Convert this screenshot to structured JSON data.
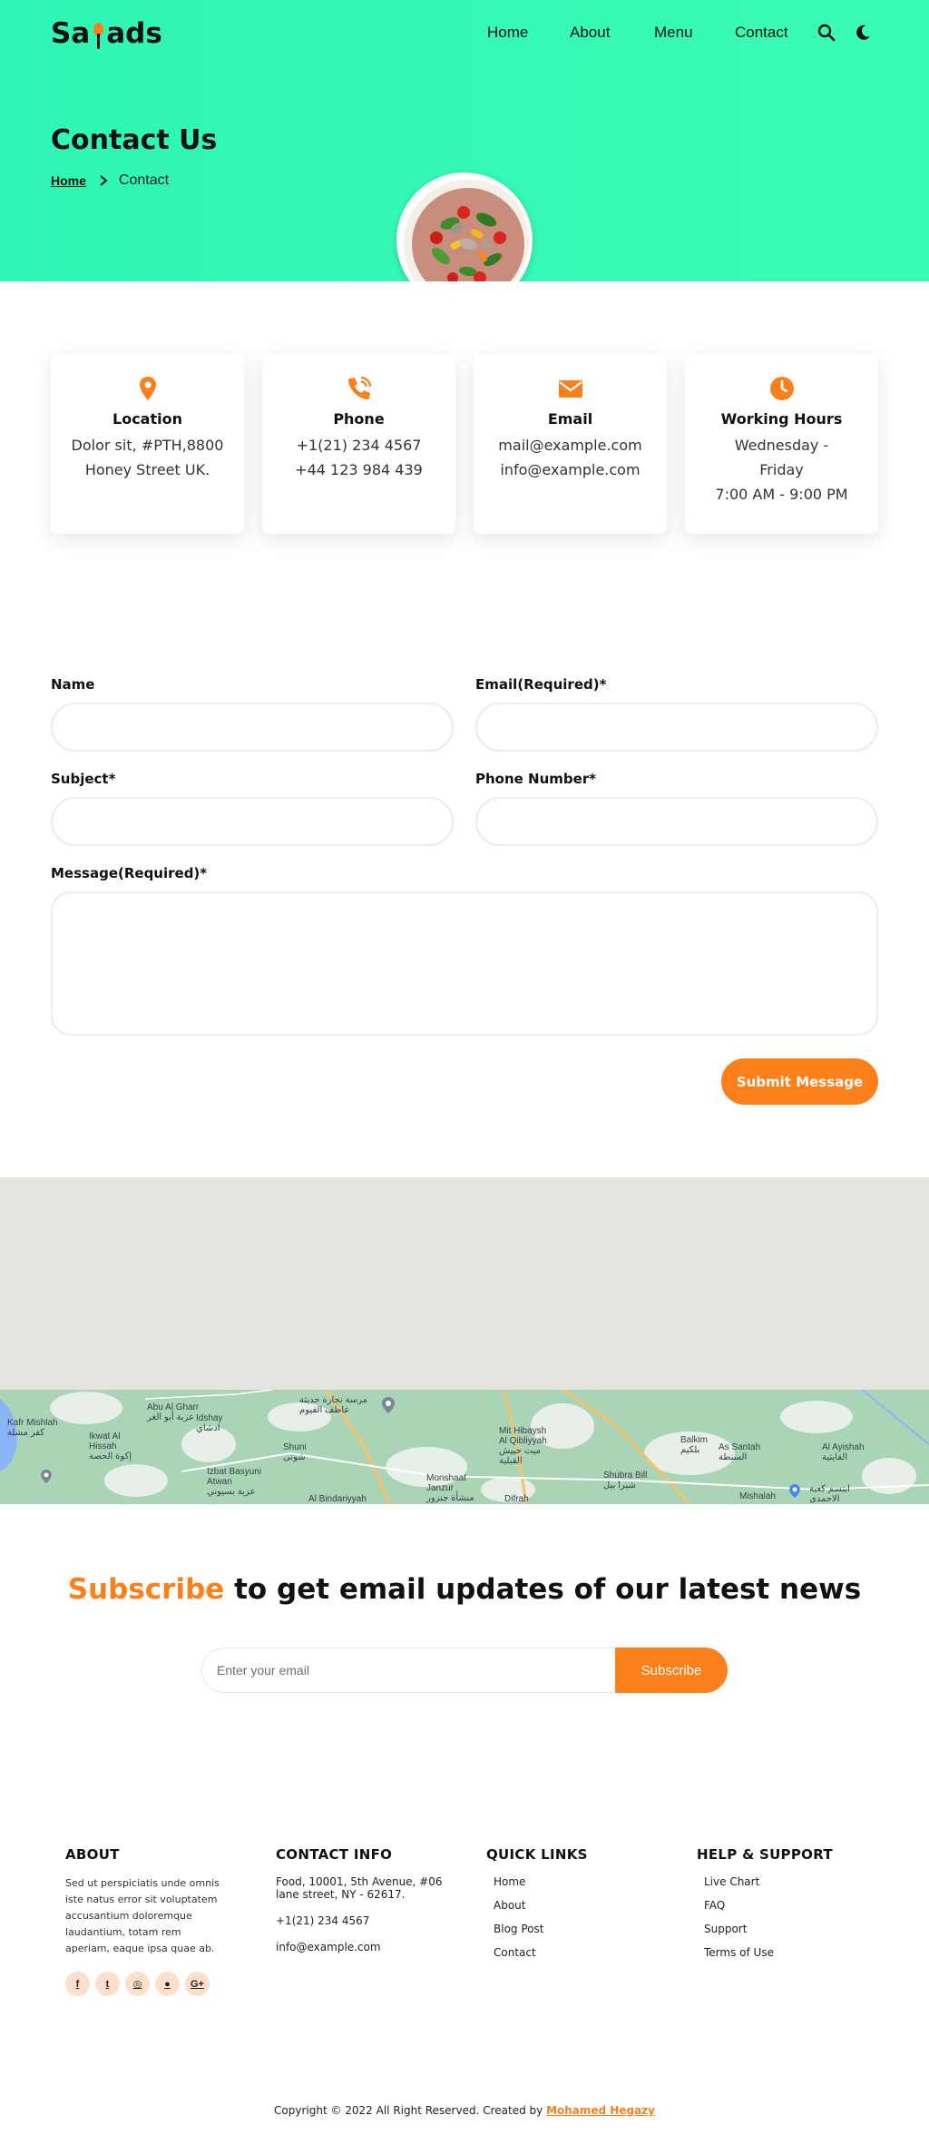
{
  "brand": {
    "logo_prefix": "Sa",
    "logo_suffix": "ads"
  },
  "nav": {
    "items": [
      {
        "label": "Home"
      },
      {
        "label": "About"
      },
      {
        "label": "Menu"
      },
      {
        "label": "Contact"
      }
    ]
  },
  "hero": {
    "title": "Contact Us",
    "breadcrumb_home": "Home",
    "breadcrumb_current": "Contact"
  },
  "info_cards": [
    {
      "title": "Location",
      "lines": [
        "Dolor sit, #PTH,8800",
        "Honey Street UK."
      ],
      "icon": "map-pin-icon"
    },
    {
      "title": "Phone",
      "lines": [
        "+1(21) 234 4567",
        "+44 123 984 439"
      ],
      "icon": "phone-icon"
    },
    {
      "title": "Email",
      "lines": [
        "mail@example.com",
        "info@example.com"
      ],
      "icon": "envelope-icon"
    },
    {
      "title": "Working Hours",
      "lines": [
        "Wednesday -",
        "Friday",
        "7:00 AM - 9:00 PM"
      ],
      "icon": "clock-icon"
    }
  ],
  "form": {
    "name_label": "Name",
    "email_label": "Email(Required)*",
    "subject_label": "Subject*",
    "phone_label": "Phone Number*",
    "message_label": "Message(Required)*",
    "name_value": "",
    "email_value": "",
    "subject_value": "",
    "phone_value": "",
    "message_value": "",
    "submit_label": "Submit Message"
  },
  "map": {
    "labels": [
      {
        "text": "Kafr Mishlah\nكفر مشلة"
      },
      {
        "text": "Abu Al Gharr\nعزبة أبو الغر"
      },
      {
        "text": "Idshay\nادشاي"
      },
      {
        "text": "Ikwat Al\nHissah\nإكوة الحصة"
      },
      {
        "text": "Shuni\nشونى"
      },
      {
        "text": "Izbat Basyuni\nAtwan\nعزبة بسيوني"
      },
      {
        "text": "Mit Hibaysh\nAl Qibliyyah\nميت حبيش\nالقبلية"
      },
      {
        "text": "Monshaat\nJanzur\nمنشأة جنزور"
      },
      {
        "text": "Shubra Bill\nشبرا بيل"
      },
      {
        "text": "Balkim\nبلكيم"
      },
      {
        "text": "As Santah\nالسنطة"
      },
      {
        "text": "Al Ayishah\nالقايتية"
      },
      {
        "text": "Mishalah"
      },
      {
        "text": "Difrah"
      },
      {
        "text": "Al Bindariyyah"
      },
      {
        "text": "مرسة نجارة حديثة\nعاطف الفيوم"
      },
      {
        "text": "ابتسم كعبة\nالاحمدى"
      }
    ]
  },
  "subscribe": {
    "heading_accent": "Subscribe",
    "heading_rest": " to get email updates of our latest news",
    "placeholder": "Enter your email",
    "button_label": "Subscribe"
  },
  "footer": {
    "about_title": "ABOUT",
    "about_text": "Sed ut perspiciatis unde omnis iste natus error sit voluptatem accusantium doloremque laudantium, totam rem aperiam, eaque ipsa quae ab.",
    "socials": [
      {
        "icon": "facebook-icon",
        "glyph": "f"
      },
      {
        "icon": "twitter-icon",
        "glyph": "t"
      },
      {
        "icon": "instagram-icon",
        "glyph": "◎"
      },
      {
        "icon": "github-icon",
        "glyph": "●"
      },
      {
        "icon": "google-plus-icon",
        "glyph": "G+"
      }
    ],
    "contact_title": "CONTACT INFO",
    "contact_address": "Food, 10001, 5th Avenue, #06 lane street, NY - 62617.",
    "contact_phone": "+1(21) 234 4567",
    "contact_email": "info@example.com",
    "quick_title": "QUICK LINKS",
    "quick_links": [
      {
        "label": "Home"
      },
      {
        "label": "About"
      },
      {
        "label": "Blog Post"
      },
      {
        "label": "Contact"
      }
    ],
    "help_title": "HELP & SUPPORT",
    "help_links": [
      {
        "label": "Live Chart"
      },
      {
        "label": "FAQ"
      },
      {
        "label": "Support"
      },
      {
        "label": "Terms of Use"
      }
    ],
    "copyright_text": "Copyright © 2022 All Right Reserved. Created by ",
    "copyright_author": "Mohamed Hegazy"
  },
  "colors": {
    "accent": "#fb7f1b",
    "hero_bg": "#2ff5b6",
    "map_land": "#e5e3df",
    "map_green": "#a9d5b6"
  }
}
